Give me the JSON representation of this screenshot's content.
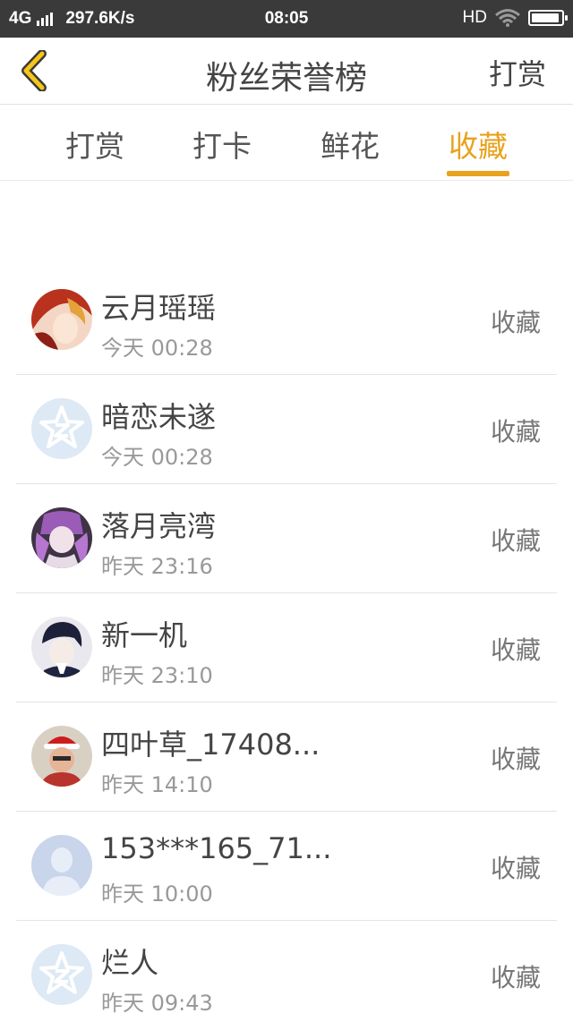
{
  "status_bar": {
    "network": "4G",
    "speed": "297.6K/s",
    "time": "08:05",
    "hd": "HD",
    "battery_level": 0.95
  },
  "header": {
    "title": "粉丝荣誉榜",
    "action": "打赏",
    "back_icon": "chevron-left-icon",
    "accent_color": "#e8a21e"
  },
  "tabs": [
    {
      "label": "打赏",
      "active": false
    },
    {
      "label": "打卡",
      "active": false
    },
    {
      "label": "鲜花",
      "active": false
    },
    {
      "label": "收藏",
      "active": true
    }
  ],
  "list": [
    {
      "name": "云月瑶瑶",
      "time": "今天 00:28",
      "type": "收藏",
      "avatar": "anime-avatar-red"
    },
    {
      "name": "暗恋未遂",
      "time": "今天 00:28",
      "type": "收藏",
      "avatar": "default-z-avatar"
    },
    {
      "name": "落月亮湾",
      "time": "昨天 23:16",
      "type": "收藏",
      "avatar": "anime-avatar-purple"
    },
    {
      "name": "新一机",
      "time": "昨天 23:10",
      "type": "收藏",
      "avatar": "anime-avatar-boy"
    },
    {
      "name": "四叶草_17408...",
      "time": "昨天 14:10",
      "type": "收藏",
      "avatar": "photo-avatar-santa-hat"
    },
    {
      "name": "153***165_71...",
      "time": "昨天 10:00",
      "type": "收藏",
      "avatar": "default-person-avatar"
    },
    {
      "name": "烂人",
      "time": "昨天 09:43",
      "type": "收藏",
      "avatar": "default-z-avatar"
    }
  ]
}
